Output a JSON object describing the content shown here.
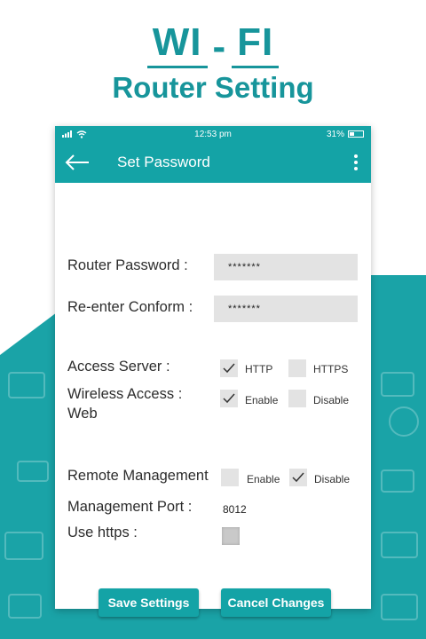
{
  "hero": {
    "line1a": "WI",
    "line1b": "-",
    "line1c": "FI",
    "line2": "Router Setting"
  },
  "status": {
    "time": "12:53 pm",
    "battery": "31%"
  },
  "appbar": {
    "title": "Set Password",
    "back_icon": "arrow-left-icon",
    "menu_icon": "more-vertical-icon"
  },
  "form": {
    "router_password_label": "Router Password :",
    "router_password_value": "*******",
    "reenter_label": "Re-enter Conform :",
    "reenter_value": "*******",
    "access_server_label": "Access Server :",
    "access_http": "HTTP",
    "access_https": "HTTPS",
    "wireless_label_1": "Wireless Access :",
    "wireless_label_2": "Web",
    "wireless_enable": "Enable",
    "wireless_disable": "Disable",
    "remote_label": "Remote Management",
    "remote_enable": "Enable",
    "remote_disable": "Disable",
    "port_label": "Management Port :",
    "port_value": "8012",
    "https_label": "Use https :"
  },
  "buttons": {
    "save": "Save Settings",
    "cancel": "Cancel Changes"
  },
  "colors": {
    "accent": "#14a3a6",
    "title": "#17959b",
    "background_teal": "#1aa3a7"
  }
}
